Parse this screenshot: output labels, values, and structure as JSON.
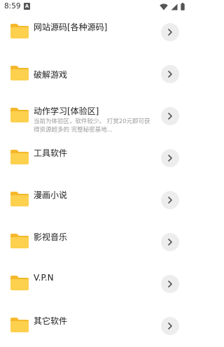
{
  "status_bar": {
    "time": "8:59",
    "notification_glyph": "A"
  },
  "folders": [
    {
      "title": "网站源码[各种源码]",
      "description": ""
    },
    {
      "title": "破解游戏",
      "description": ""
    },
    {
      "title": "动作学习[体验区]",
      "description": "当前为体验区，软件较少。 打赏20元即可获得资源超多的 完整秘密基地..."
    },
    {
      "title": "工具软件",
      "description": ""
    },
    {
      "title": "漫画小说",
      "description": ""
    },
    {
      "title": "影视音乐",
      "description": ""
    },
    {
      "title": "V.P.N",
      "description": ""
    },
    {
      "title": "其它软件",
      "description": ""
    }
  ],
  "colors": {
    "folder_front": "#FDD04E",
    "folder_back": "#F5B82C",
    "chevron_bg": "#EDEDED"
  }
}
